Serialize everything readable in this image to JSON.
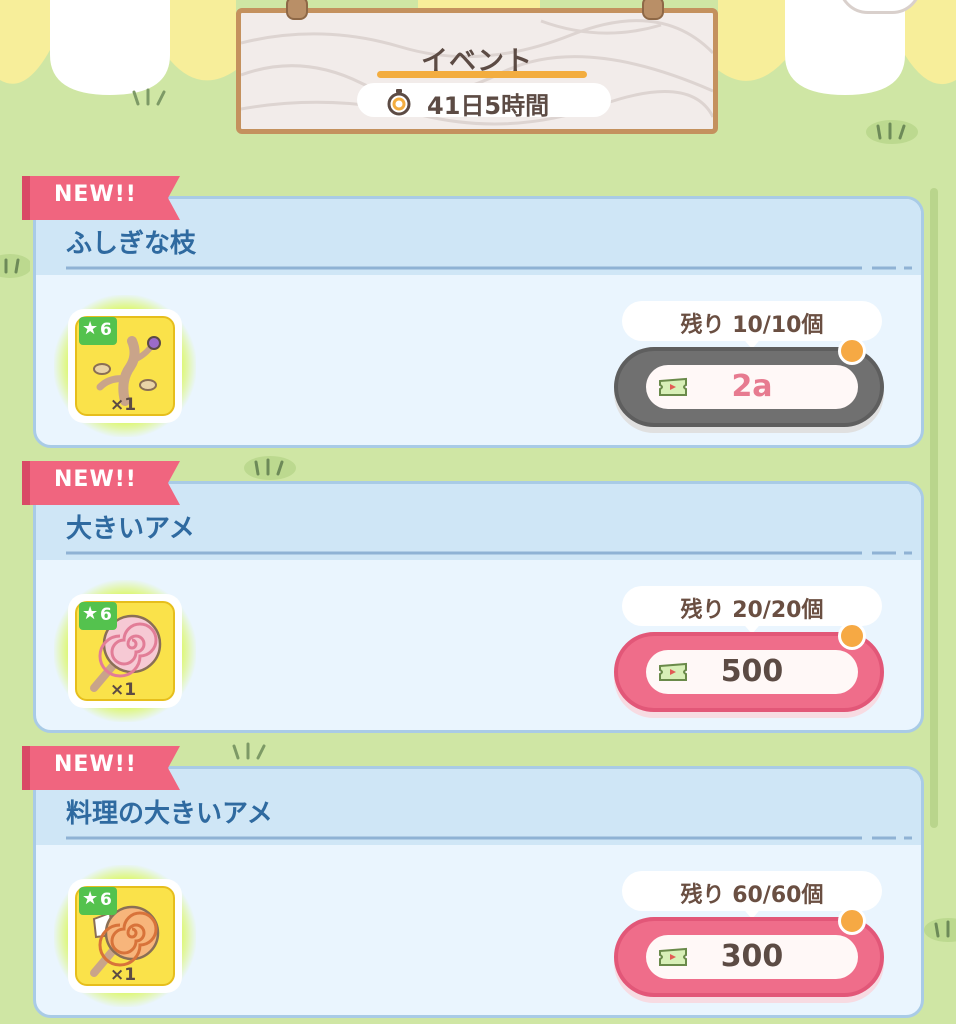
{
  "header": {
    "title": "イベント",
    "timer": "41日5時間"
  },
  "items": [
    {
      "new_label": "NEW!!",
      "name": "ふしぎな枝",
      "level": "6",
      "quantity": "×1",
      "icon": "mysterious-branch-icon",
      "remaining": "残り 10/10個",
      "price": "2a",
      "price_icon": "ticket-icon",
      "button_state": "disabled"
    },
    {
      "new_label": "NEW!!",
      "name": "大きいアメ",
      "level": "6",
      "quantity": "×1",
      "icon": "pink-lollipop-icon",
      "remaining": "残り 20/20個",
      "price": "500",
      "price_icon": "ticket-icon",
      "button_state": "enabled"
    },
    {
      "new_label": "NEW!!",
      "name": "料理の大きいアメ",
      "level": "6",
      "quantity": "×1",
      "icon": "orange-lollipop-icon",
      "remaining": "残り 60/60個",
      "price": "300",
      "price_icon": "ticket-icon",
      "button_state": "enabled"
    }
  ],
  "colors": {
    "background": "#cfe6a4",
    "card_border": "#a9cbe6",
    "card_title": "#2f6aa0",
    "new_ribbon": "#f0657f",
    "buy_button": "#ef6d8a",
    "buy_button_disabled": "#707070",
    "item_tile": "#fae24a"
  }
}
